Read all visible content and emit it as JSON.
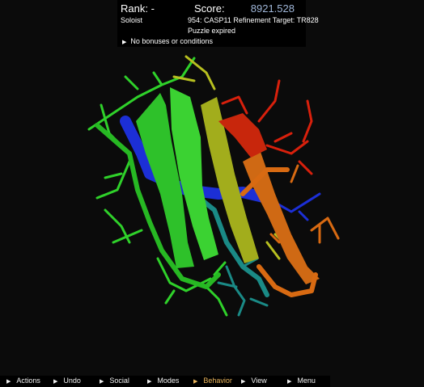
{
  "header": {
    "rank_label": "Rank: -",
    "score_label": "Score:",
    "score_value": "8921.528",
    "player": "Soloist",
    "puzzle_title": "954: CASP11 Refinement Target: TR828",
    "status": "Puzzle expired",
    "bonus_text": "No bonuses or conditions",
    "bonus_icon": "triangle-right-icon"
  },
  "toolbar": {
    "items": [
      {
        "label": "Actions"
      },
      {
        "label": "Undo"
      },
      {
        "label": "Social"
      },
      {
        "label": "Modes"
      },
      {
        "label": "Behavior",
        "active": true
      },
      {
        "label": "View"
      },
      {
        "label": "Menu"
      }
    ]
  },
  "colors": {
    "background": "#0b0b0b",
    "score_value": "#9fb6d8",
    "active_menu": "#e8b45c",
    "protein_blue": "#1c2fd6",
    "protein_teal": "#1a8a86",
    "protein_green": "#2fd12a",
    "protein_yellow": "#a8b01c",
    "protein_orange": "#d86a12",
    "protein_red": "#d8200c"
  }
}
